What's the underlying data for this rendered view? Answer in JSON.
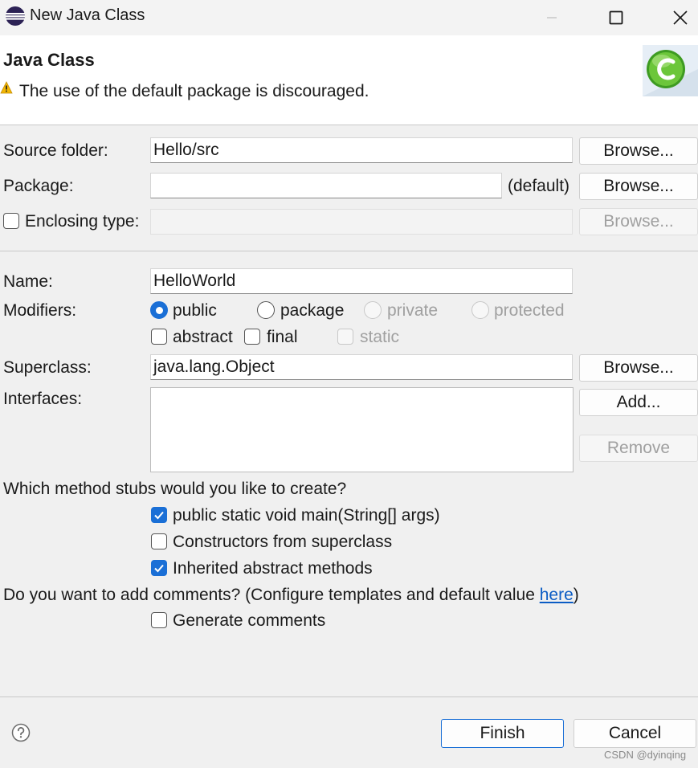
{
  "window": {
    "title": "New Java Class"
  },
  "header": {
    "title": "Java Class",
    "message": "The use of the default package is discouraged.",
    "warning_icon": "warning-icon",
    "logo_icon": "java-class-wizard-icon"
  },
  "form": {
    "source_folder": {
      "label": "Source folder:",
      "value": "Hello/src",
      "browse": "Browse..."
    },
    "package": {
      "label": "Package:",
      "value": "",
      "suffix": "(default)",
      "browse": "Browse..."
    },
    "enclosing_type": {
      "label": "Enclosing type:",
      "checked": false,
      "value": "",
      "browse": "Browse..."
    },
    "name": {
      "label": "Name:",
      "value": "HelloWorld"
    },
    "modifiers": {
      "label": "Modifiers:",
      "radios": [
        "public",
        "package",
        "private",
        "protected"
      ],
      "selected": "public",
      "checks": [
        "abstract",
        "final",
        "static"
      ]
    },
    "superclass": {
      "label": "Superclass:",
      "value": "java.lang.Object",
      "browse": "Browse..."
    },
    "interfaces": {
      "label": "Interfaces:",
      "add": "Add...",
      "remove": "Remove"
    },
    "stubs": {
      "question": "Which method stubs would you like to create?",
      "items": [
        {
          "label": "public static void main(String[] args)",
          "checked": true
        },
        {
          "label": "Constructors from superclass",
          "checked": false
        },
        {
          "label": "Inherited abstract methods",
          "checked": true
        }
      ]
    },
    "comments": {
      "question_prefix": "Do you want to add comments? (Configure templates and default value ",
      "link": "here",
      "question_suffix": ")",
      "generate_label": "Generate comments",
      "checked": false
    }
  },
  "footer": {
    "finish": "Finish",
    "cancel": "Cancel",
    "help_icon": "help-icon"
  },
  "watermark": "CSDN @dyinqing",
  "colors": {
    "accent": "#1a6fd6",
    "link": "#0b5cc4",
    "warning": "#f2b705",
    "logo_green": "#4caf2e"
  }
}
